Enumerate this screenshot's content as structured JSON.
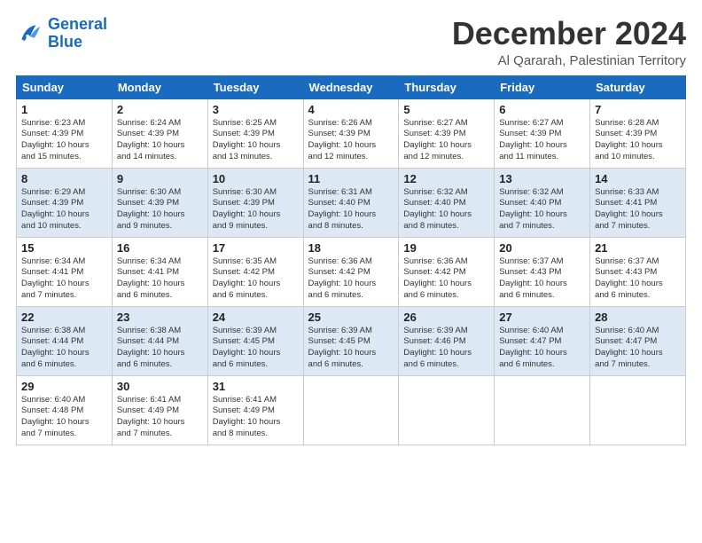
{
  "logo": {
    "line1": "General",
    "line2": "Blue"
  },
  "title": "December 2024",
  "subtitle": "Al Qararah, Palestinian Territory",
  "days_of_week": [
    "Sunday",
    "Monday",
    "Tuesday",
    "Wednesday",
    "Thursday",
    "Friday",
    "Saturday"
  ],
  "weeks": [
    [
      {
        "day": "1",
        "info": "Sunrise: 6:23 AM\nSunset: 4:39 PM\nDaylight: 10 hours\nand 15 minutes."
      },
      {
        "day": "2",
        "info": "Sunrise: 6:24 AM\nSunset: 4:39 PM\nDaylight: 10 hours\nand 14 minutes."
      },
      {
        "day": "3",
        "info": "Sunrise: 6:25 AM\nSunset: 4:39 PM\nDaylight: 10 hours\nand 13 minutes."
      },
      {
        "day": "4",
        "info": "Sunrise: 6:26 AM\nSunset: 4:39 PM\nDaylight: 10 hours\nand 12 minutes."
      },
      {
        "day": "5",
        "info": "Sunrise: 6:27 AM\nSunset: 4:39 PM\nDaylight: 10 hours\nand 12 minutes."
      },
      {
        "day": "6",
        "info": "Sunrise: 6:27 AM\nSunset: 4:39 PM\nDaylight: 10 hours\nand 11 minutes."
      },
      {
        "day": "7",
        "info": "Sunrise: 6:28 AM\nSunset: 4:39 PM\nDaylight: 10 hours\nand 10 minutes."
      }
    ],
    [
      {
        "day": "8",
        "info": "Sunrise: 6:29 AM\nSunset: 4:39 PM\nDaylight: 10 hours\nand 10 minutes."
      },
      {
        "day": "9",
        "info": "Sunrise: 6:30 AM\nSunset: 4:39 PM\nDaylight: 10 hours\nand 9 minutes."
      },
      {
        "day": "10",
        "info": "Sunrise: 6:30 AM\nSunset: 4:39 PM\nDaylight: 10 hours\nand 9 minutes."
      },
      {
        "day": "11",
        "info": "Sunrise: 6:31 AM\nSunset: 4:40 PM\nDaylight: 10 hours\nand 8 minutes."
      },
      {
        "day": "12",
        "info": "Sunrise: 6:32 AM\nSunset: 4:40 PM\nDaylight: 10 hours\nand 8 minutes."
      },
      {
        "day": "13",
        "info": "Sunrise: 6:32 AM\nSunset: 4:40 PM\nDaylight: 10 hours\nand 7 minutes."
      },
      {
        "day": "14",
        "info": "Sunrise: 6:33 AM\nSunset: 4:41 PM\nDaylight: 10 hours\nand 7 minutes."
      }
    ],
    [
      {
        "day": "15",
        "info": "Sunrise: 6:34 AM\nSunset: 4:41 PM\nDaylight: 10 hours\nand 7 minutes."
      },
      {
        "day": "16",
        "info": "Sunrise: 6:34 AM\nSunset: 4:41 PM\nDaylight: 10 hours\nand 6 minutes."
      },
      {
        "day": "17",
        "info": "Sunrise: 6:35 AM\nSunset: 4:42 PM\nDaylight: 10 hours\nand 6 minutes."
      },
      {
        "day": "18",
        "info": "Sunrise: 6:36 AM\nSunset: 4:42 PM\nDaylight: 10 hours\nand 6 minutes."
      },
      {
        "day": "19",
        "info": "Sunrise: 6:36 AM\nSunset: 4:42 PM\nDaylight: 10 hours\nand 6 minutes."
      },
      {
        "day": "20",
        "info": "Sunrise: 6:37 AM\nSunset: 4:43 PM\nDaylight: 10 hours\nand 6 minutes."
      },
      {
        "day": "21",
        "info": "Sunrise: 6:37 AM\nSunset: 4:43 PM\nDaylight: 10 hours\nand 6 minutes."
      }
    ],
    [
      {
        "day": "22",
        "info": "Sunrise: 6:38 AM\nSunset: 4:44 PM\nDaylight: 10 hours\nand 6 minutes."
      },
      {
        "day": "23",
        "info": "Sunrise: 6:38 AM\nSunset: 4:44 PM\nDaylight: 10 hours\nand 6 minutes."
      },
      {
        "day": "24",
        "info": "Sunrise: 6:39 AM\nSunset: 4:45 PM\nDaylight: 10 hours\nand 6 minutes."
      },
      {
        "day": "25",
        "info": "Sunrise: 6:39 AM\nSunset: 4:45 PM\nDaylight: 10 hours\nand 6 minutes."
      },
      {
        "day": "26",
        "info": "Sunrise: 6:39 AM\nSunset: 4:46 PM\nDaylight: 10 hours\nand 6 minutes."
      },
      {
        "day": "27",
        "info": "Sunrise: 6:40 AM\nSunset: 4:47 PM\nDaylight: 10 hours\nand 6 minutes."
      },
      {
        "day": "28",
        "info": "Sunrise: 6:40 AM\nSunset: 4:47 PM\nDaylight: 10 hours\nand 7 minutes."
      }
    ],
    [
      {
        "day": "29",
        "info": "Sunrise: 6:40 AM\nSunset: 4:48 PM\nDaylight: 10 hours\nand 7 minutes."
      },
      {
        "day": "30",
        "info": "Sunrise: 6:41 AM\nSunset: 4:49 PM\nDaylight: 10 hours\nand 7 minutes."
      },
      {
        "day": "31",
        "info": "Sunrise: 6:41 AM\nSunset: 4:49 PM\nDaylight: 10 hours\nand 8 minutes."
      },
      {
        "day": "",
        "info": ""
      },
      {
        "day": "",
        "info": ""
      },
      {
        "day": "",
        "info": ""
      },
      {
        "day": "",
        "info": ""
      }
    ]
  ]
}
